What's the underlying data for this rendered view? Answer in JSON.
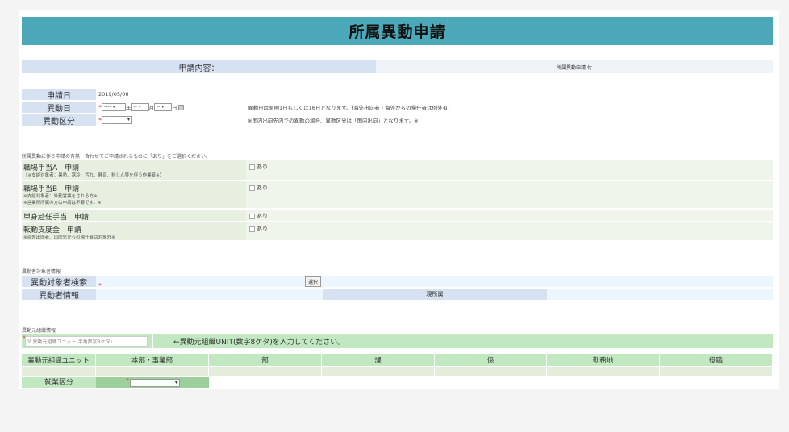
{
  "title": "所属異動申請",
  "request_content": {
    "label": "申請内容：",
    "value": "所属異動申請 付"
  },
  "form": {
    "apply_date": {
      "label": "申請日",
      "value": "2019/05/06"
    },
    "transfer_date": {
      "label": "異動日",
      "year_placeholder": "----",
      "month_placeholder": "--",
      "day_placeholder": "--",
      "year_unit": "年",
      "month_unit": "月",
      "day_unit": "日",
      "note": "異動日は原則1日もしくは16日となります。(海外出向者・海外からの帰任者は例外有)"
    },
    "transfer_type": {
      "label": "異動区分",
      "value": "",
      "note": "※国内出向先内での異動の場合、異動区分は「国内出向」となります。※"
    }
  },
  "allowances": {
    "intro": "所属異動に伴う申請の有無　合わせてご申請されるものに「あり」をご選択ください。",
    "items": [
      {
        "title": "職場手当A　申請",
        "notes": [
          "【※支給対象者：暑熱、寒冷、汚れ、騒音、粉じん等を伴う作業者※】"
        ],
        "option": "あり",
        "checked": false
      },
      {
        "title": "職場手当B　申請",
        "notes": [
          "※支給対象者：外勤営業をされる方※",
          "※営業所所属の方は申請は不要です。※"
        ],
        "option": "あり",
        "checked": false
      },
      {
        "title": "単身赴任手当　申請",
        "notes": [],
        "option": "あり",
        "checked": false
      },
      {
        "title": "転勤支度金　申請",
        "notes": [
          "※海外出向者、出向先からの帰任者は対象外※"
        ],
        "option": "あり",
        "checked": false
      }
    ]
  },
  "target": {
    "section": "異動者対象者情報",
    "search_label": "異動対象者検索",
    "select_button": "選択",
    "info_label": "異動者情報",
    "current_label": "現所属"
  },
  "source_org": {
    "section": "異動元組織情報",
    "input_placeholder": "異動元組織ユニット(半角数字8ケタ)",
    "hint": "←異動元組織UNIT(数字8ケタ)を入力してください。",
    "columns": [
      "異動元組織ユニット",
      "本部・事業部",
      "部",
      "課",
      "係",
      "勤務地",
      "役職"
    ],
    "employment_label": "就業区分"
  }
}
